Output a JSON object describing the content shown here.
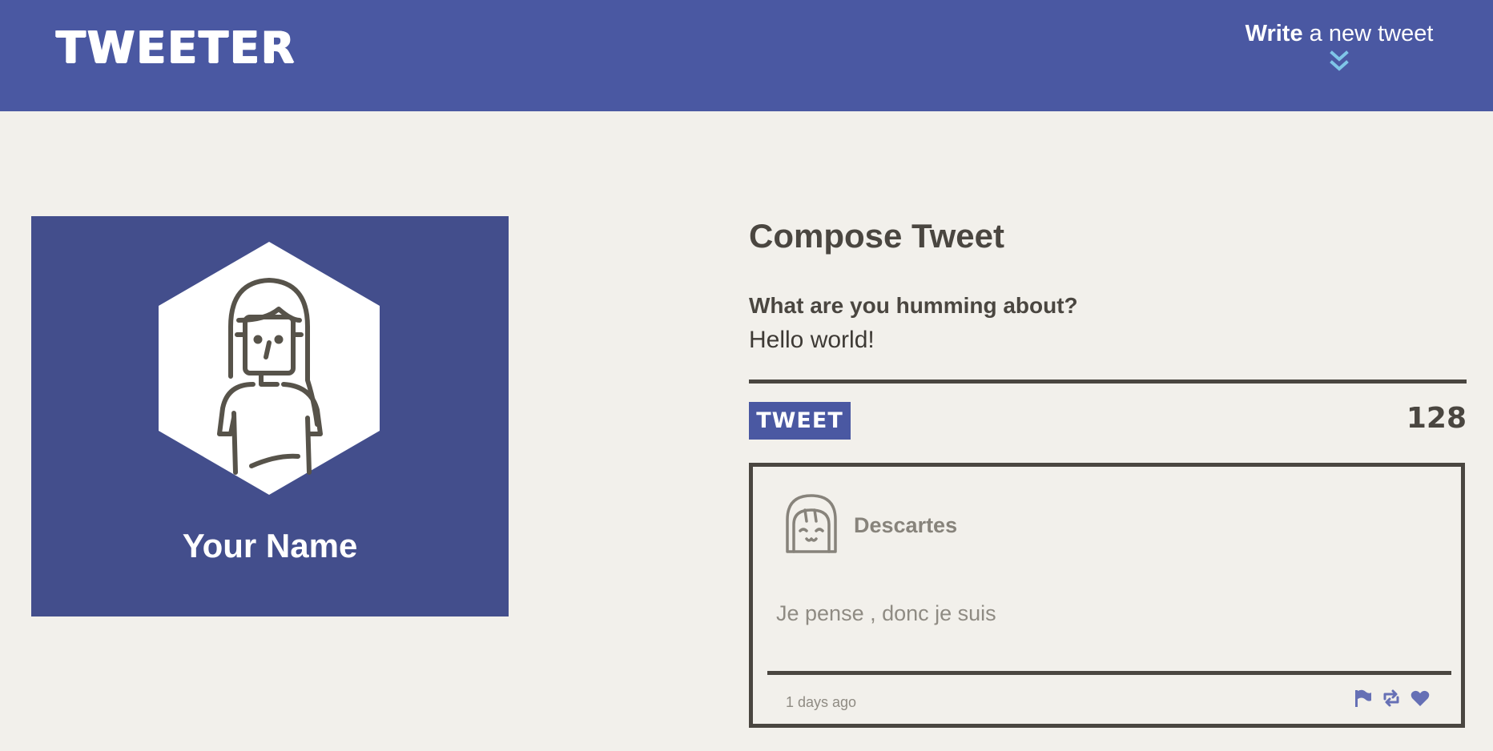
{
  "header": {
    "brand": "TWEETER",
    "compose_toggle_bold": "Write",
    "compose_toggle_rest": " a new tweet",
    "toggle_icon": "double-chevron-down-icon"
  },
  "profile": {
    "name": "Your Name",
    "avatar_icon": "person-avatar-icon"
  },
  "compose": {
    "title": "Compose Tweet",
    "prompt": "What are you humming about?",
    "input_value": "Hello world!",
    "tweet_button": "TWEET",
    "char_count": "128"
  },
  "tweets": [
    {
      "author": "Descartes",
      "avatar_icon": "smiling-avatar-icon",
      "text": "Je pense , donc je suis",
      "time": "1 days ago",
      "actions": [
        "flag-icon",
        "retweet-icon",
        "heart-icon"
      ]
    }
  ],
  "colors": {
    "brand": "#4a58a2",
    "profile_bg": "#434e8c",
    "background": "#f2f0eb",
    "text_dark": "#4a4640",
    "text_muted": "#8f8b83",
    "action_icons": "#6670b5",
    "toggle_icon": "#7fc5e8"
  }
}
